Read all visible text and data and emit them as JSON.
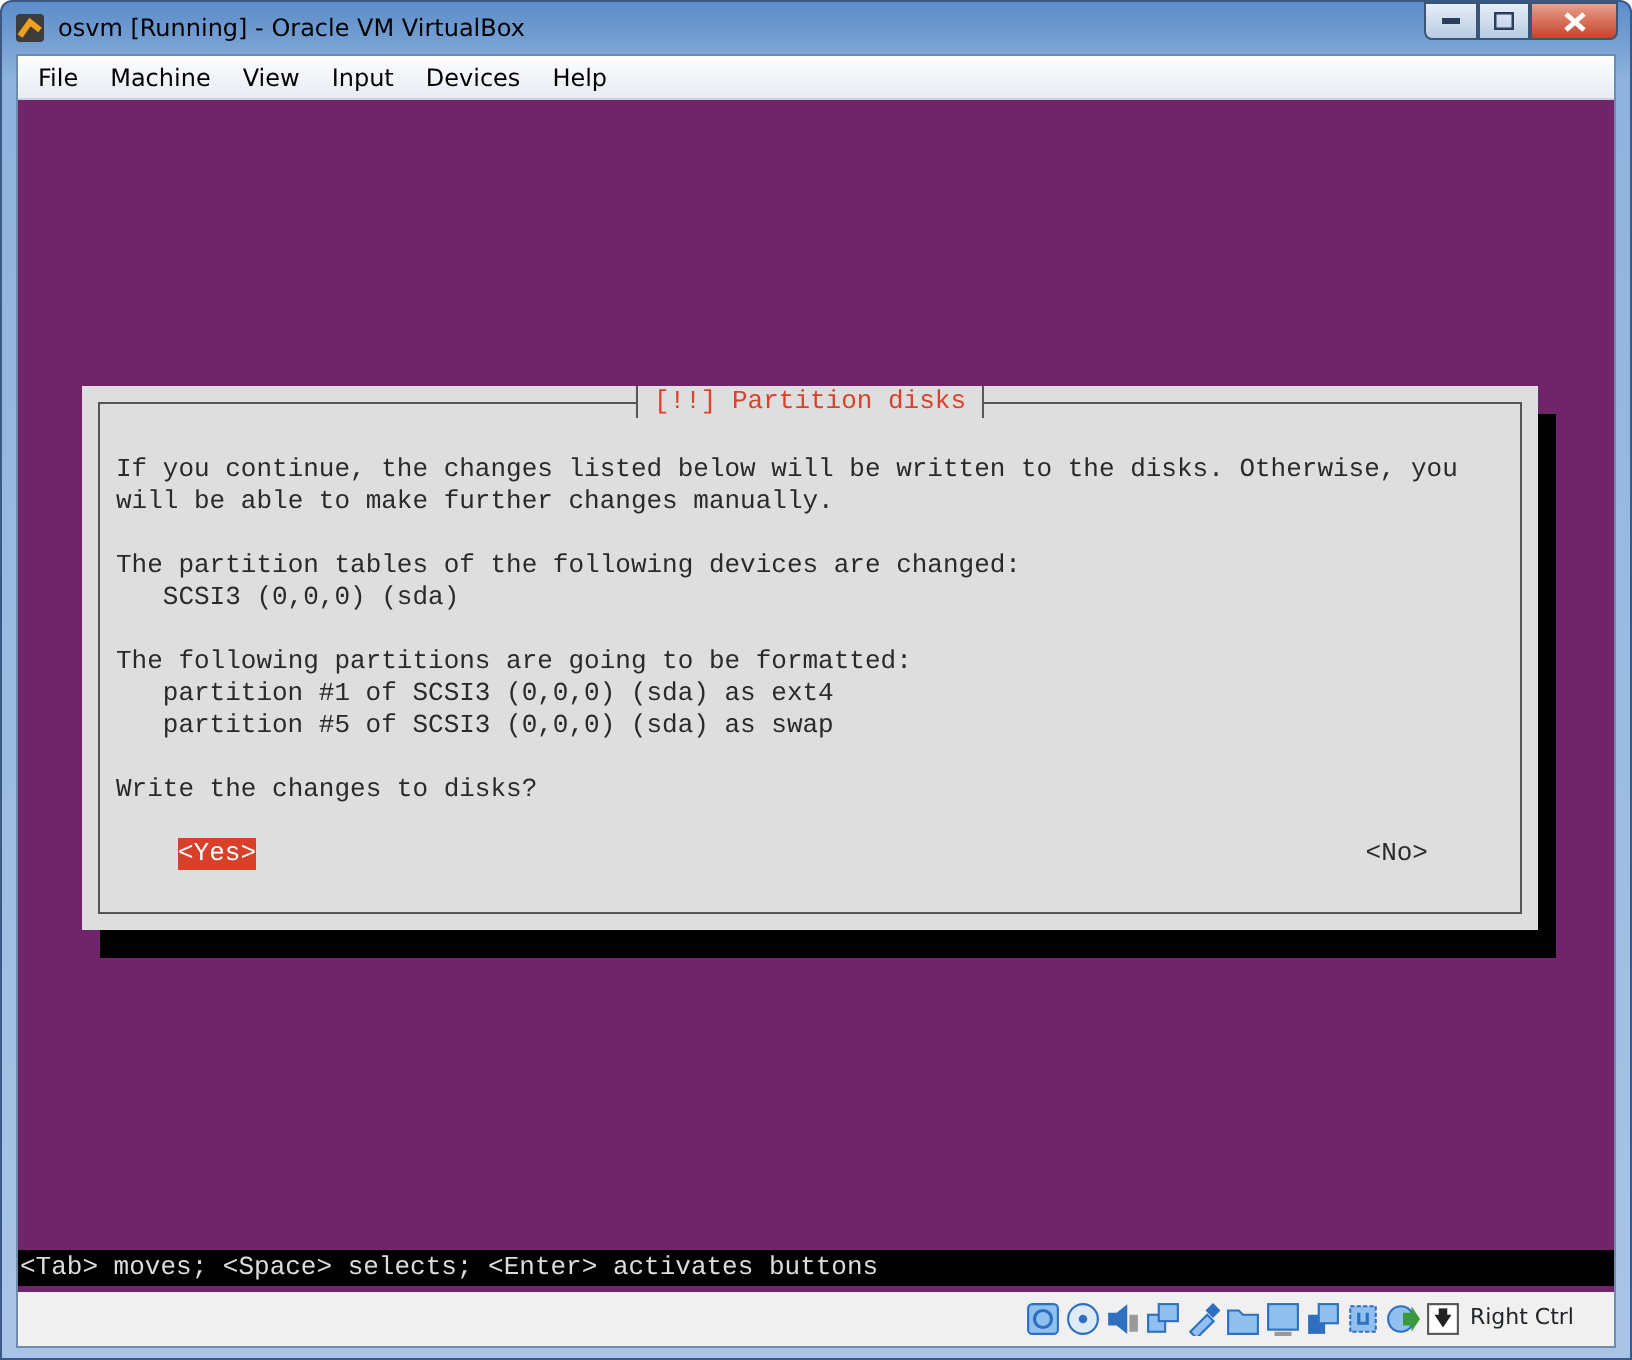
{
  "window": {
    "title": "osvm [Running] - Oracle VM VirtualBox"
  },
  "menu": [
    "File",
    "Machine",
    "View",
    "Input",
    "Devices",
    "Help"
  ],
  "dialog": {
    "title": "[!!] Partition disks",
    "paragraphs": [
      {
        "lines": [
          {
            "text": "If you continue, the changes listed below will be written to the disks. Otherwise, you will be able to make further changes manually.",
            "indented": false
          }
        ]
      },
      {
        "lines": [
          {
            "text": "The partition tables of the following devices are changed:",
            "indented": false
          },
          {
            "text": "SCSI3 (0,0,0) (sda)",
            "indented": true
          }
        ]
      },
      {
        "lines": [
          {
            "text": "The following partitions are going to be formatted:",
            "indented": false
          },
          {
            "text": "partition #1 of SCSI3 (0,0,0) (sda) as ext4",
            "indented": true
          },
          {
            "text": "partition #5 of SCSI3 (0,0,0) (sda) as swap",
            "indented": true
          }
        ]
      },
      {
        "lines": [
          {
            "text": "Write the changes to disks?",
            "indented": false
          }
        ]
      }
    ],
    "buttons": [
      {
        "label": "<Yes>",
        "selected": true
      },
      {
        "label": "<No>",
        "selected": false
      }
    ]
  },
  "hint": "<Tab> moves; <Space> selects; <Enter> activates buttons",
  "status_bar": {
    "host_key": "Right Ctrl"
  }
}
